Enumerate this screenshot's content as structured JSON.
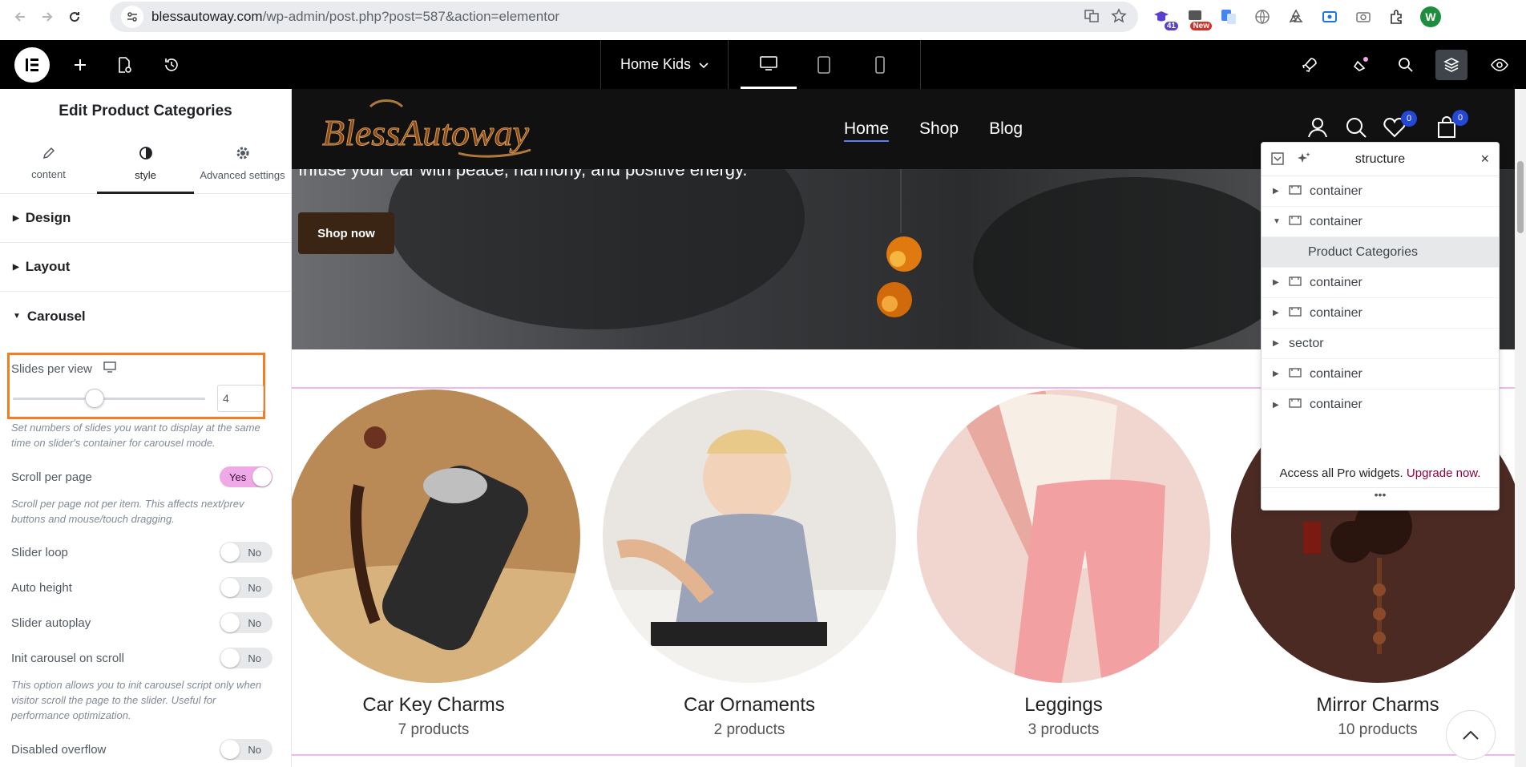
{
  "browser": {
    "url_domain": "blessautoway.com",
    "url_path": "/wp-admin/post.php?post=587&action=elementor",
    "ext_badge_1": "41",
    "ext_badge_2": "New",
    "profile_letter": "W"
  },
  "topbar": {
    "page_name": "Home Kids"
  },
  "panel": {
    "title": "Edit Product Categories",
    "tabs": [
      {
        "label": "content"
      },
      {
        "label": "style"
      },
      {
        "label": "Advanced settings"
      }
    ],
    "sections": {
      "design": "Design",
      "layout": "Layout",
      "carousel": "Carousel"
    },
    "slides_per_view": {
      "label": "Slides per view",
      "value": "4",
      "hint": "Set numbers of slides you want to display at the same time on slider's container for carousel mode."
    },
    "scroll_per_page": {
      "label": "Scroll per page",
      "value": "Yes",
      "hint": "Scroll per page not per item. This affects next/prev buttons and mouse/touch dragging."
    },
    "slider_loop": {
      "label": "Slider loop",
      "value": "No"
    },
    "auto_height": {
      "label": "Auto height",
      "value": "No"
    },
    "slider_autoplay": {
      "label": "Slider autoplay",
      "value": "No"
    },
    "init_carousel": {
      "label": "Init carousel on scroll",
      "value": "No",
      "hint": "This option allows you to init carousel script only when visitor scroll the page to the slider. Useful for performance optimization."
    },
    "disabled_overflow": {
      "label": "Disabled overflow",
      "value": "No"
    }
  },
  "site": {
    "logo_text": "BlessAutoway",
    "nav": [
      "Home",
      "Shop",
      "Blog"
    ],
    "wishlist_count": "0",
    "cart_count": "0",
    "hero_text": "Infuse your car with peace, harmony, and positive energy.",
    "hero_button": "Shop now",
    "categories": [
      {
        "name": "Car Key Charms",
        "count": "7 products"
      },
      {
        "name": "Car Ornaments",
        "count": "2 products"
      },
      {
        "name": "Leggings",
        "count": "3 products"
      },
      {
        "name": "Mirror Charms",
        "count": "10 products"
      }
    ]
  },
  "navigator": {
    "title": "structure",
    "rows": [
      {
        "label": "container"
      },
      {
        "label": "container"
      },
      {
        "label": "Product Categories"
      },
      {
        "label": "container"
      },
      {
        "label": "container"
      },
      {
        "label": "sector"
      },
      {
        "label": "container"
      },
      {
        "label": "container"
      }
    ],
    "footer_text": "Access all Pro widgets.",
    "footer_link": "Upgrade now."
  }
}
